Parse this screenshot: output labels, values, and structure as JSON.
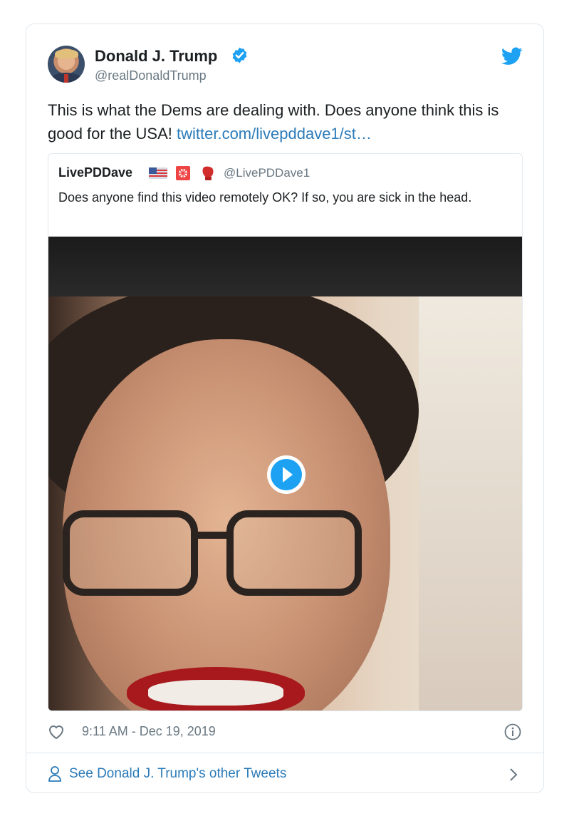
{
  "author": {
    "name": "Donald J. Trump",
    "handle": "@realDonaldTrump",
    "avatar_icon": "avatar-photo",
    "verified_icon": "verified-badge-icon",
    "verified_color": "#1da1f2"
  },
  "brand": {
    "icon": "twitter-bird-icon",
    "color": "#1da1f2"
  },
  "tweet": {
    "text": "This is what the Dems are dealing with. Does anyone think this is good for the USA! ",
    "link": "twitter.com/livepddave1/st…",
    "link_color": "#2b7bb9"
  },
  "quoted": {
    "name": "LivePDDave",
    "emojis": [
      "us-flag-icon",
      "police-light-icon",
      "boxing-glove-icon"
    ],
    "handle": "@LivePDDave1",
    "text": "Does anyone find this video remotely OK? If so, you are sick in the head.",
    "media": {
      "type": "video",
      "play_icon": "play-button-icon"
    }
  },
  "footer": {
    "like_icon": "heart-icon",
    "timestamp": "9:11 AM - Dec 19, 2019",
    "info_icon": "info-icon",
    "more_icon": "person-icon",
    "more_text": "See Donald J. Trump's other Tweets",
    "chevron_icon": "chevron-right-icon"
  }
}
